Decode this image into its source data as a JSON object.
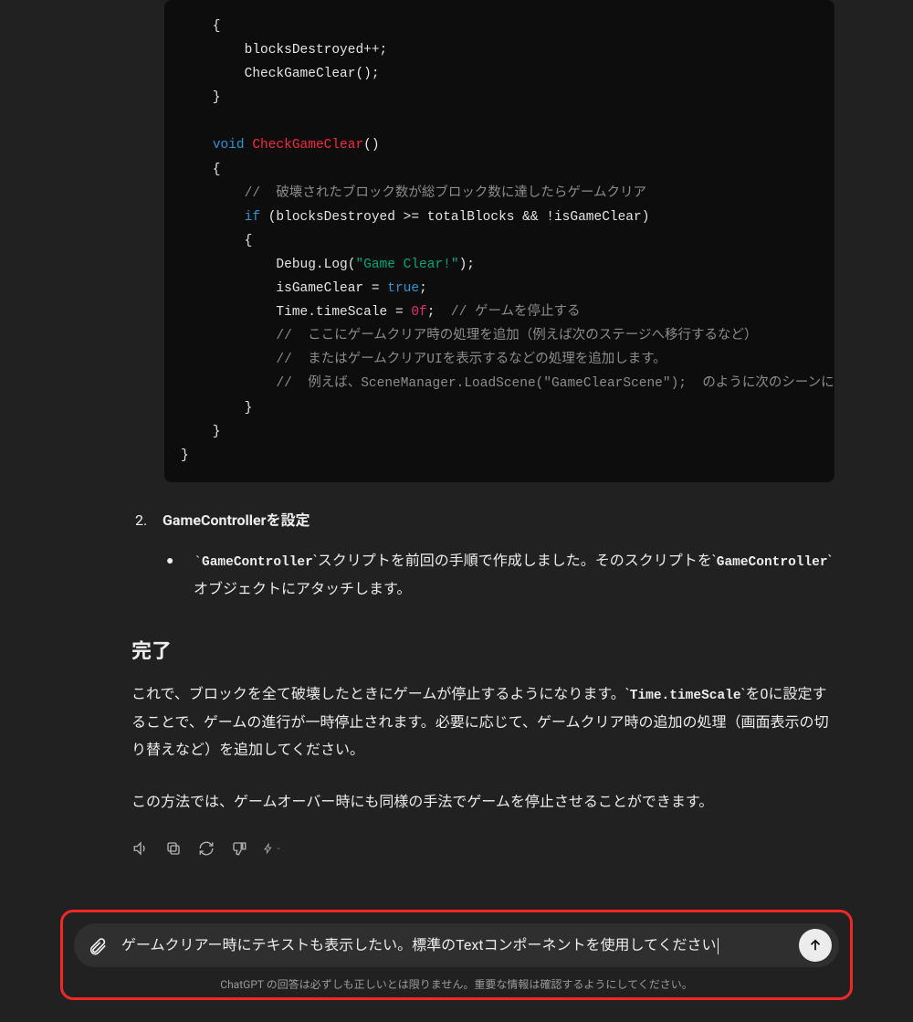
{
  "code": {
    "line1_a": "blocksDestroyed++;",
    "line1_b": "CheckGameClear();",
    "kw_void": "void",
    "fn_name": "CheckGameClear",
    "fn_sig_tail": "()",
    "cm_destroyed": "//  破壊されたブロック数が総ブロック数に達したらゲームクリア",
    "kw_if": "if",
    "if_cond": " (blocksDestroyed >= totalBlocks && !isGameClear)",
    "debug_pre": "Debug.Log(",
    "debug_str": "\"Game Clear!\"",
    "debug_post": ");",
    "isclear_pre": "isGameClear = ",
    "bool_true": "true",
    "semicolon": ";",
    "timescale_pre": "Time.timeScale = ",
    "num_0f": "0f",
    "timescale_post": ";  ",
    "cm_stop": "// ゲームを停止する",
    "cm_add1": "//  ここにゲームクリア時の処理を追加（例えば次のステージへ移行するなど）",
    "cm_add2": "//  またはゲームクリアUIを表示するなどの処理を追加します。",
    "cm_add3": "//  例えば、SceneManager.LoadScene(\"GameClearScene\");  のように次のシーンに遷"
  },
  "step2": {
    "number": "2.",
    "title_bold": "GameControllerを設定",
    "bullet_pre_tick": "`",
    "bullet_code1": "GameController",
    "bullet_mid1": "`スクリプトを前回の手順で作成しました。そのスクリプトを`",
    "bullet_code2": "GameController",
    "bullet_mid2": "`オブジェクトにアタッチします。"
  },
  "done": {
    "heading": "完了",
    "p1_a": "これで、ブロックを全て破壊したときにゲームが停止するようになります。`",
    "p1_code": "Time.timeScale",
    "p1_b": "`を0に設定することで、ゲームの進行が一時停止されます。必要に応じて、ゲームクリア時の追加の処理（画面表示の切り替えなど）を追加してください。",
    "p2": "この方法では、ゲームオーバー時にも同様の手法でゲームを停止させることができます。"
  },
  "composer": {
    "text": "ゲームクリアー時にテキストも表示したい。標準のTextコンポーネントを使用してください",
    "disclaimer": "ChatGPT の回答は必ずしも正しいとは限りません。重要な情報は確認するようにしてください。"
  }
}
